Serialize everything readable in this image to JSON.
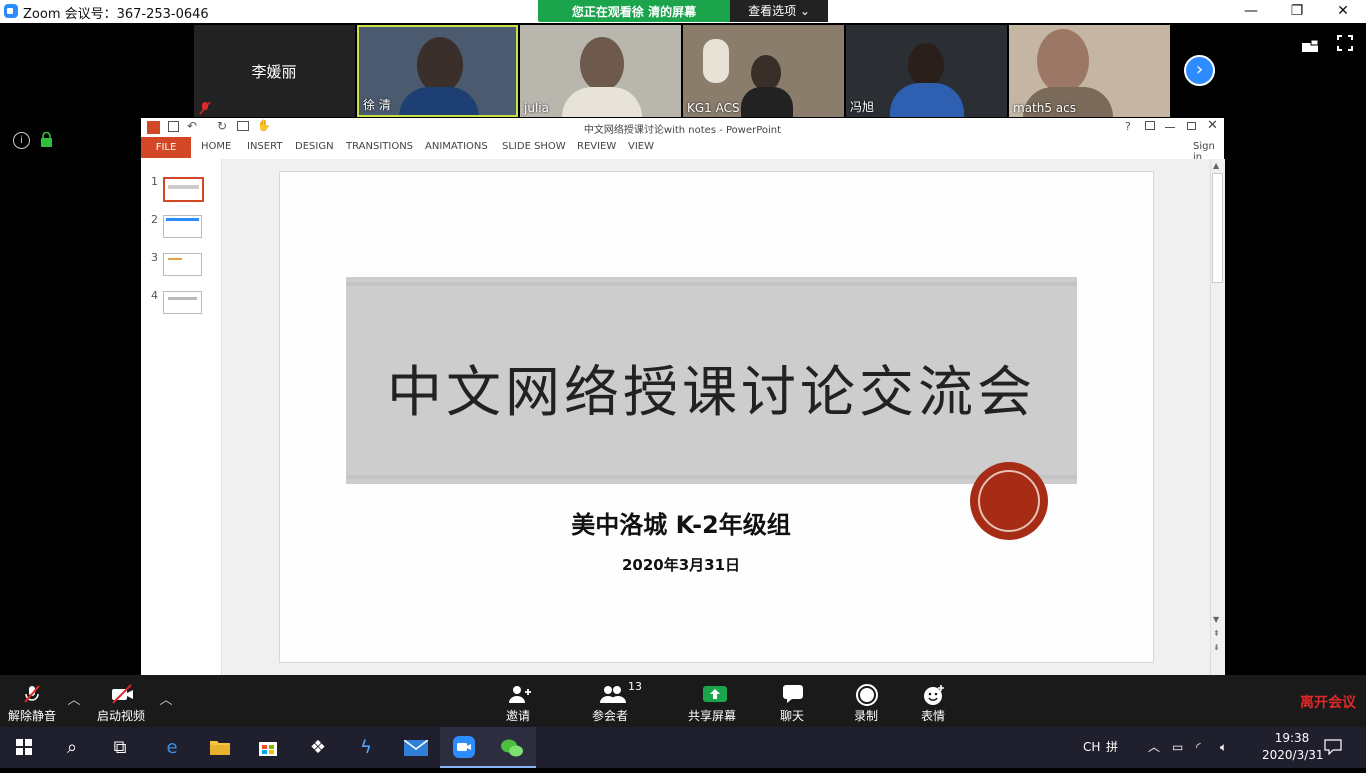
{
  "window": {
    "title": "Zoom 会议号：367-253-0646",
    "minimize": "—",
    "restore": "❐",
    "close": "✕"
  },
  "share_banner": {
    "text": "您正在观看徐 清的屏幕",
    "view_options": "查看选项 ⌄"
  },
  "participants": [
    {
      "name": "李媛丽",
      "video": false,
      "muted": true
    },
    {
      "name": "徐 清",
      "video": true,
      "active": true
    },
    {
      "name": "julia",
      "video": true
    },
    {
      "name": "KG1 ACS",
      "video": true
    },
    {
      "name": "冯旭",
      "video": true
    },
    {
      "name": "math5 acs",
      "video": true
    }
  ],
  "powerpoint": {
    "title": "中文网络授课讨论with notes - PowerPoint",
    "sign_in": "Sign in",
    "file_tab": "FILE",
    "tabs": [
      "HOME",
      "INSERT",
      "DESIGN",
      "TRANSITIONS",
      "ANIMATIONS",
      "SLIDE SHOW",
      "REVIEW",
      "VIEW"
    ],
    "help": "?",
    "thumbnails": [
      "1",
      "2",
      "3",
      "4"
    ],
    "selected_slide": 1
  },
  "slide": {
    "title": "中文网络授课讨论交流会",
    "subtitle": "美中洛城 K-2年级组",
    "date": "2020年3月31日"
  },
  "controls": {
    "unmute": "解除静音",
    "start_video": "启动视频",
    "invite": "邀请",
    "participants": "参会者",
    "participant_count": "13",
    "share_screen": "共享屏幕",
    "chat": "聊天",
    "record": "录制",
    "reactions": "表情",
    "leave": "离开会议"
  },
  "taskbar": {
    "lang": "CH",
    "ime": "拼",
    "time": "19:38",
    "date": "2020/3/31"
  },
  "colors": {
    "zoom_blue": "#2d8cff",
    "share_green": "#1aa54c",
    "ppt_orange": "#d24726",
    "seal_red": "#a62c15",
    "leave_red": "#e02828"
  }
}
